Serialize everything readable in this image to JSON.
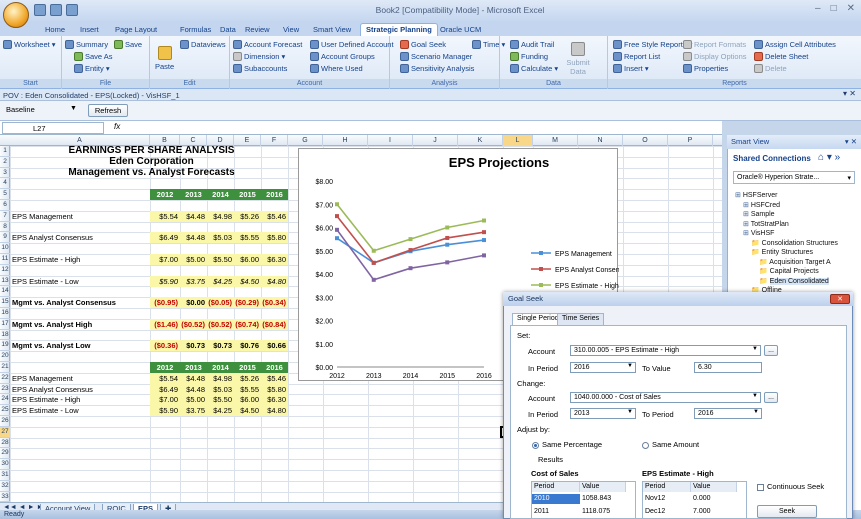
{
  "window": {
    "title": "Book2 [Compatibility Mode] - Microsoft Excel",
    "controls": [
      "–",
      "□",
      "✕"
    ]
  },
  "tabs": [
    "Home",
    "Insert",
    "Page Layout",
    "Formulas",
    "Data",
    "Review",
    "View",
    "Smart View",
    "Strategic Planning",
    "Oracle UCM"
  ],
  "ribbon": {
    "start": {
      "label": "Start",
      "worksheet": "Worksheet ▾"
    },
    "file": {
      "label": "File",
      "summary": "Summary",
      "save": "Save",
      "save_as": "Save As",
      "entity": "Entity ▾"
    },
    "edit": {
      "label": "Edit",
      "paste": "Paste",
      "dataviews": "Dataviews"
    },
    "account": {
      "label": "Account",
      "forecast": "Account Forecast",
      "dimension": "Dimension ▾",
      "subaccounts": "Subaccounts",
      "user_defined": "User Defined Account",
      "account_groups": "Account Groups",
      "where_used": "Where Used"
    },
    "analysis": {
      "label": "Analysis",
      "goal_seek": "Goal Seek",
      "scenario_manager": "Scenario Manager",
      "sensitivity": "Sensitivity Analysis",
      "time": "Time ▾"
    },
    "data": {
      "label": "Data",
      "audit_trail": "Audit Trail",
      "funding": "Funding",
      "calculate": "Calculate ▾",
      "submit_data": "Submit Data"
    },
    "reports": {
      "label": "Reports",
      "free_style": "Free Style Reports ▾",
      "report_list": "Report List",
      "insert": "Insert ▾",
      "report_formats": "Report Formats",
      "display_options": "Display Options",
      "properties": "Properties",
      "assign_cell": "Assign Cell Attributes",
      "delete_sheet": "Delete Sheet",
      "delete": "Delete"
    }
  },
  "pov": {
    "text": "POV : Eden Consolidated - EPS(Locked) - VisHSF_1",
    "scenario": "Baseline",
    "refresh": "Refresh",
    "close": "▾ ✕"
  },
  "formula": {
    "namebox": "L27",
    "fx": "fx",
    "value": ""
  },
  "columns": [
    "A",
    "B",
    "C",
    "D",
    "E",
    "F",
    "G",
    "H",
    "I",
    "J",
    "K",
    "L",
    "M",
    "N",
    "O",
    "P",
    "Q"
  ],
  "rows": [
    "1",
    "2",
    "3",
    "4",
    "5",
    "6",
    "7",
    "8",
    "9",
    "10",
    "11",
    "12",
    "13",
    "14",
    "15",
    "16",
    "17",
    "18",
    "19",
    "20",
    "21",
    "22",
    "23",
    "24",
    "25",
    "26",
    "27",
    "28",
    "29",
    "30",
    "31",
    "32",
    "33"
  ],
  "sheet": {
    "title1": "EARNINGS PER SHARE ANALYSIS",
    "title2": "Eden Corporation",
    "title3": "Management vs. Analyst Forecasts",
    "years": [
      "2012",
      "2013",
      "2014",
      "2015",
      "2016"
    ],
    "rows": [
      {
        "label": "EPS Management",
        "vals": [
          "$5.54",
          "$4.48",
          "$4.98",
          "$5.26",
          "$5.46"
        ]
      },
      {
        "label": "EPS Analyst Consensus",
        "vals": [
          "$6.49",
          "$4.48",
          "$5.03",
          "$5.55",
          "$5.80"
        ]
      },
      {
        "label": "EPS Estimate - High",
        "vals": [
          "$7.00",
          "$5.00",
          "$5.50",
          "$6.00",
          "$6.30"
        ]
      },
      {
        "label": "EPS Estimate - Low",
        "vals": [
          "$5.90",
          "$3.75",
          "$4.25",
          "$4.50",
          "$4.80"
        ]
      }
    ],
    "diffs": [
      {
        "label": "Mgmt vs. Analyst Consensus",
        "vals": [
          "($0.95)",
          "$0.00",
          "($0.05)",
          "($0.29)",
          "($0.34)"
        ]
      },
      {
        "label": "Mgmt vs. Analyst High",
        "vals": [
          "($1.46)",
          "($0.52)",
          "($0.52)",
          "($0.74)",
          "($0.84)"
        ]
      },
      {
        "label": "Mgmt vs. Analyst Low",
        "vals": [
          "($0.36)",
          "$0.73",
          "$0.73",
          "$0.76",
          "$0.66"
        ]
      }
    ]
  },
  "sheet_tabs": [
    "Account View",
    "ROIC",
    "EPS"
  ],
  "status": "Ready",
  "chart_data": {
    "type": "line",
    "title": "EPS Projections",
    "categories": [
      "2012",
      "2013",
      "2014",
      "2015",
      "2016"
    ],
    "series": [
      {
        "name": "EPS Management",
        "values": [
          5.54,
          4.48,
          4.98,
          5.26,
          5.46
        ],
        "color": "#4a90d9"
      },
      {
        "name": "EPS Analyst Consensus",
        "values": [
          6.49,
          4.48,
          5.03,
          5.55,
          5.8
        ],
        "color": "#c0504d"
      },
      {
        "name": "EPS Estimate - High",
        "values": [
          7.0,
          5.0,
          5.5,
          6.0,
          6.3
        ],
        "color": "#9bbb59"
      },
      {
        "name": "EPS Estimate - Low",
        "values": [
          5.9,
          3.75,
          4.25,
          4.5,
          4.8
        ],
        "color": "#8064a2"
      }
    ],
    "ylim": [
      0,
      8
    ],
    "yticks": [
      "$0.00",
      "$1.00",
      "$2.00",
      "$3.00",
      "$4.00",
      "$5.00",
      "$6.00",
      "$7.00",
      "$8.00"
    ],
    "grid": false,
    "legend": "right"
  },
  "smartview": {
    "title": "Smart View",
    "shared": "Shared Connections",
    "server_select": "Oracle® Hyperion Strate...",
    "tree": [
      "HSFServer",
      "HSFCred",
      "Sample",
      "TotStratPlan",
      "VisHSF",
      "Consolidation Structures",
      "Entity Structures",
      "Acquisition Target A",
      "Capital Projects",
      "Eden Consolidated",
      "Offline"
    ]
  },
  "dialog": {
    "title": "Goal Seek",
    "tabs": [
      "Single Period",
      "Time Series"
    ],
    "set": "Set:",
    "account_label": "Account",
    "set_account": "310.00.005 - EPS Estimate - High",
    "in_period_label": "In Period",
    "set_period": "2016",
    "to_value_label": "To Value",
    "to_value": "6.30",
    "change": "Change:",
    "change_account": "1040.00.000 - Cost of Sales",
    "change_period": "2013",
    "to_period_label": "To Period",
    "to_period": "2016",
    "adjust_by": "Adjust by:",
    "same_pct": "Same Percentage",
    "same_amt": "Same Amount",
    "results": "Results",
    "table1_title": "Cost of Sales",
    "table1_cols": [
      "Period",
      "Value"
    ],
    "table1_rows": [
      [
        "2010",
        "1058.843"
      ],
      [
        "2011",
        "1118.075"
      ]
    ],
    "table2_title": "EPS Estimate - High",
    "table2_cols": [
      "Period",
      "Value"
    ],
    "table2_rows": [
      [
        "Nov12",
        "0.000"
      ],
      [
        "Dec12",
        "7.000"
      ]
    ],
    "continuous": "Continuous Seek",
    "seek": "Seek",
    "ellipsis": "..."
  }
}
